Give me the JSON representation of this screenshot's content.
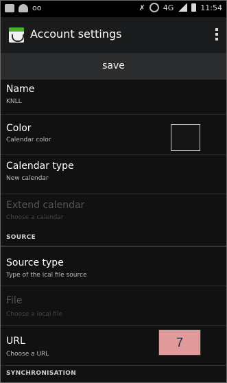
{
  "status_bar": {
    "icons": [
      "image-icon",
      "cloud-icon",
      "voicemail-icon",
      "mute-icon",
      "alarm-icon",
      "network-4g-icon",
      "signal-icon",
      "battery-icon"
    ],
    "network": "4G",
    "time": "11:54"
  },
  "action_bar": {
    "title": "Account settings",
    "icon": "calendar-sync-icon",
    "menu_icon": "overflow-menu-icon"
  },
  "save_label": "save",
  "items": [
    {
      "title": "Name",
      "subtitle": "KNLL",
      "enabled": true
    },
    {
      "title": "Color",
      "subtitle": "Calendar color",
      "enabled": true
    },
    {
      "title": "Calendar type",
      "subtitle": "New calendar",
      "enabled": true
    },
    {
      "title": "Extend calendar",
      "subtitle": "Choose a calendar",
      "enabled": false
    }
  ],
  "section_source": "SOURCE",
  "source_items": [
    {
      "title": "Source type",
      "subtitle": "Type of the ical file source",
      "enabled": true
    },
    {
      "title": "File",
      "subtitle": "Choose a local file",
      "enabled": false
    },
    {
      "title": "URL",
      "subtitle": "Choose a URL",
      "enabled": true
    }
  ],
  "section_sync": "SYNCHRONISATION",
  "annotation": "7",
  "colors": {
    "background": "#111111",
    "action_bar": "#1a1b1c",
    "save_bar": "#2b2c2e",
    "annotation_box": "#df9a99"
  }
}
